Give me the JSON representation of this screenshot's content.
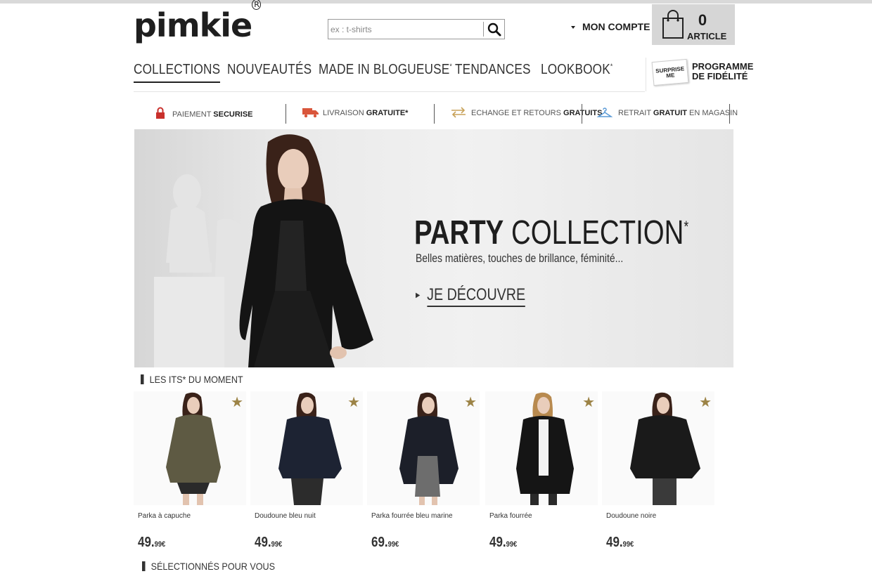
{
  "header": {
    "logo": "pimkie",
    "search_placeholder": "ex : t-shirts",
    "account_label": "MON COMPTE",
    "cart_count": "0",
    "cart_label": "ARTICLE"
  },
  "nav": {
    "items": [
      "COLLECTIONS",
      "NOUVEAUTÉS",
      "MADE IN BLOGUEUSE",
      "TENDANCES",
      "LOOKBOOK"
    ],
    "active": "COLLECTIONS",
    "loyalty_badge": "SURPRISE ME",
    "loyalty_line1": "PROGRAMME",
    "loyalty_line2": "DE FIDÉLITÉ"
  },
  "services": [
    {
      "plain": "PAIEMENT ",
      "bold": "SECURISE",
      "icon": "lock-icon"
    },
    {
      "plain": "LIVRAISON ",
      "bold": "GRATUITE*",
      "icon": "delivery-truck-icon"
    },
    {
      "plain": "ECHANGE ET RETOURS ",
      "bold": "GRATUITS",
      "icon": "exchange-arrows-icon"
    },
    {
      "plain": "RETRAIT ",
      "bold": "GRATUIT",
      "tail": " EN MAGASIN",
      "icon": "hanger-icon"
    }
  ],
  "hero": {
    "title_bold": "PARTY",
    "title_rest": " COLLECTION",
    "subtitle": "Belles matières, touches de brillance, féminité...",
    "cta": "JE DÉCOUVRE"
  },
  "sections": {
    "its": "LES ITS* DU MOMENT",
    "selected": "SÉLECTIONNÉS POUR VOUS"
  },
  "products": [
    {
      "name": "Parka à capuche",
      "price_main": "49.",
      "price_cents": "99€",
      "coat_color": "#5e5a43"
    },
    {
      "name": "Doudoune bleu nuit",
      "price_main": "49.",
      "price_cents": "99€",
      "coat_color": "#1d2333"
    },
    {
      "name": "Parka fourrée bleu marine",
      "price_main": "69.",
      "price_cents": "99€",
      "coat_color": "#1c1f29"
    },
    {
      "name": "Parka fourrée",
      "price_main": "49.",
      "price_cents": "99€",
      "coat_color": "#151515"
    },
    {
      "name": "Doudoune noire",
      "price_main": "49.",
      "price_cents": "99€",
      "coat_color": "#1a1a1a"
    }
  ],
  "colors": {
    "star": "#9c8346",
    "cart_bg": "#d6d6d6",
    "lock_red": "#c9302c",
    "hanger_blue": "#5a9ad6",
    "truck_orange": "#d9563b",
    "exchange_gold": "#c8a25a"
  }
}
